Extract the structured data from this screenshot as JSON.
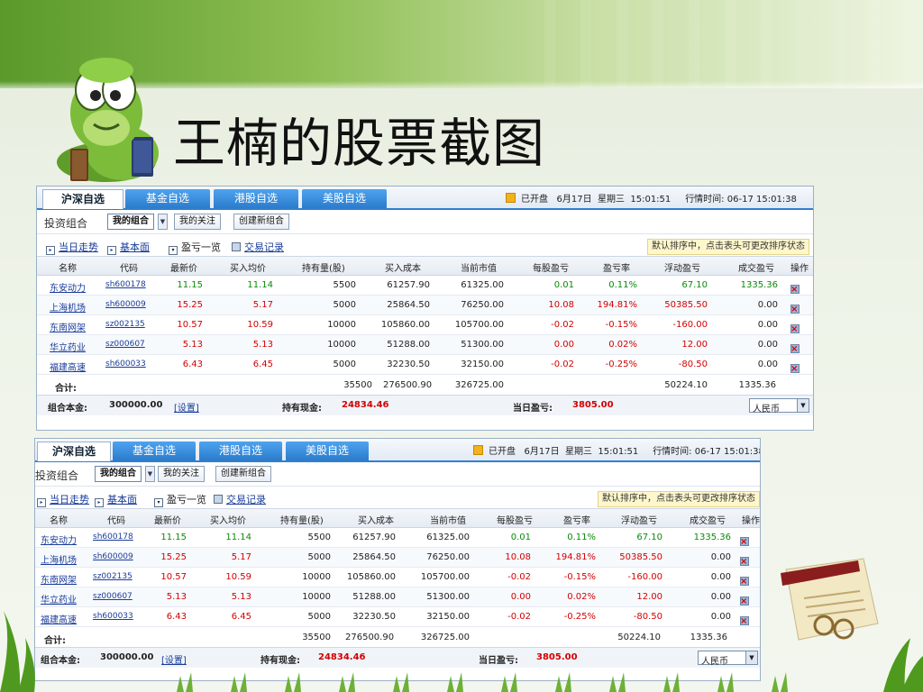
{
  "slide": {
    "title": "王楠的股票截图"
  },
  "colors": {
    "accent": "#2f7fd0",
    "up": "#d40000",
    "down": "#0a8a0a"
  },
  "panel": {
    "tabs": [
      "沪深自选",
      "基金自选",
      "港股自选",
      "美股自选"
    ],
    "market_status": "已开盘",
    "date": "6月17日",
    "weekday": "星期三",
    "time": "15:01:51",
    "quote_time_label": "行情时间:",
    "quote_time": "06-17 15:01:38",
    "portfolio_label": "投资组合",
    "portfolio_my": "我的组合",
    "portfolio_watch": "我的关注",
    "create_btn": "创建新组合",
    "links": [
      "当日走势",
      "基本面",
      "盈亏一览",
      "交易记录"
    ],
    "sort_hint": "默认排序中，点击表头可更改排序状态",
    "columns": [
      "名称",
      "代码",
      "最新价",
      "买入均价",
      "持有量(股)",
      "买入成本",
      "当前市值",
      "每股盈亏",
      "盈亏率",
      "浮动盈亏",
      "成交盈亏",
      "操作"
    ],
    "rows": [
      [
        "东安动力",
        "sh600178",
        "11.15",
        "11.14",
        "5500",
        "61257.90",
        "61325.00",
        "0.01",
        "0.11%",
        "67.10",
        "1335.36"
      ],
      [
        "上海机场",
        "sh600009",
        "15.25",
        "5.17",
        "5000",
        "25864.50",
        "76250.00",
        "10.08",
        "194.81%",
        "50385.50",
        "0.00"
      ],
      [
        "东南网架",
        "sz002135",
        "10.57",
        "10.59",
        "10000",
        "105860.00",
        "105700.00",
        "-0.02",
        "-0.15%",
        "-160.00",
        "0.00"
      ],
      [
        "华立药业",
        "sz000607",
        "5.13",
        "5.13",
        "10000",
        "51288.00",
        "51300.00",
        "0.00",
        "0.02%",
        "12.00",
        "0.00"
      ],
      [
        "福建高速",
        "sh600033",
        "6.43",
        "6.45",
        "5000",
        "32230.50",
        "32150.00",
        "-0.02",
        "-0.25%",
        "-80.50",
        "0.00"
      ]
    ],
    "row_colors": [
      [
        "g",
        "g",
        "k",
        "k",
        "k",
        "g",
        "g",
        "g",
        "g"
      ],
      [
        "r",
        "r",
        "k",
        "k",
        "k",
        "r",
        "r",
        "r",
        "k"
      ],
      [
        "r",
        "r",
        "k",
        "k",
        "k",
        "r",
        "r",
        "r",
        "k"
      ],
      [
        "r",
        "r",
        "k",
        "k",
        "k",
        "r",
        "r",
        "r",
        "k"
      ],
      [
        "r",
        "r",
        "k",
        "k",
        "k",
        "r",
        "r",
        "r",
        "k"
      ]
    ],
    "total_label": "合计:",
    "total_shares": "35500",
    "total_cost": "276500.90",
    "total_value": "326725.00",
    "total_float": "50224.10",
    "total_deal": "1335.36",
    "capital_label": "组合本金:",
    "capital_value": "300000.00",
    "capital_set": "[设置]",
    "cash_label": "持有现金:",
    "cash_value": "24834.46",
    "day_pl_label": "当日盈亏:",
    "day_pl_value": "3805.00",
    "currency": "人民币"
  }
}
